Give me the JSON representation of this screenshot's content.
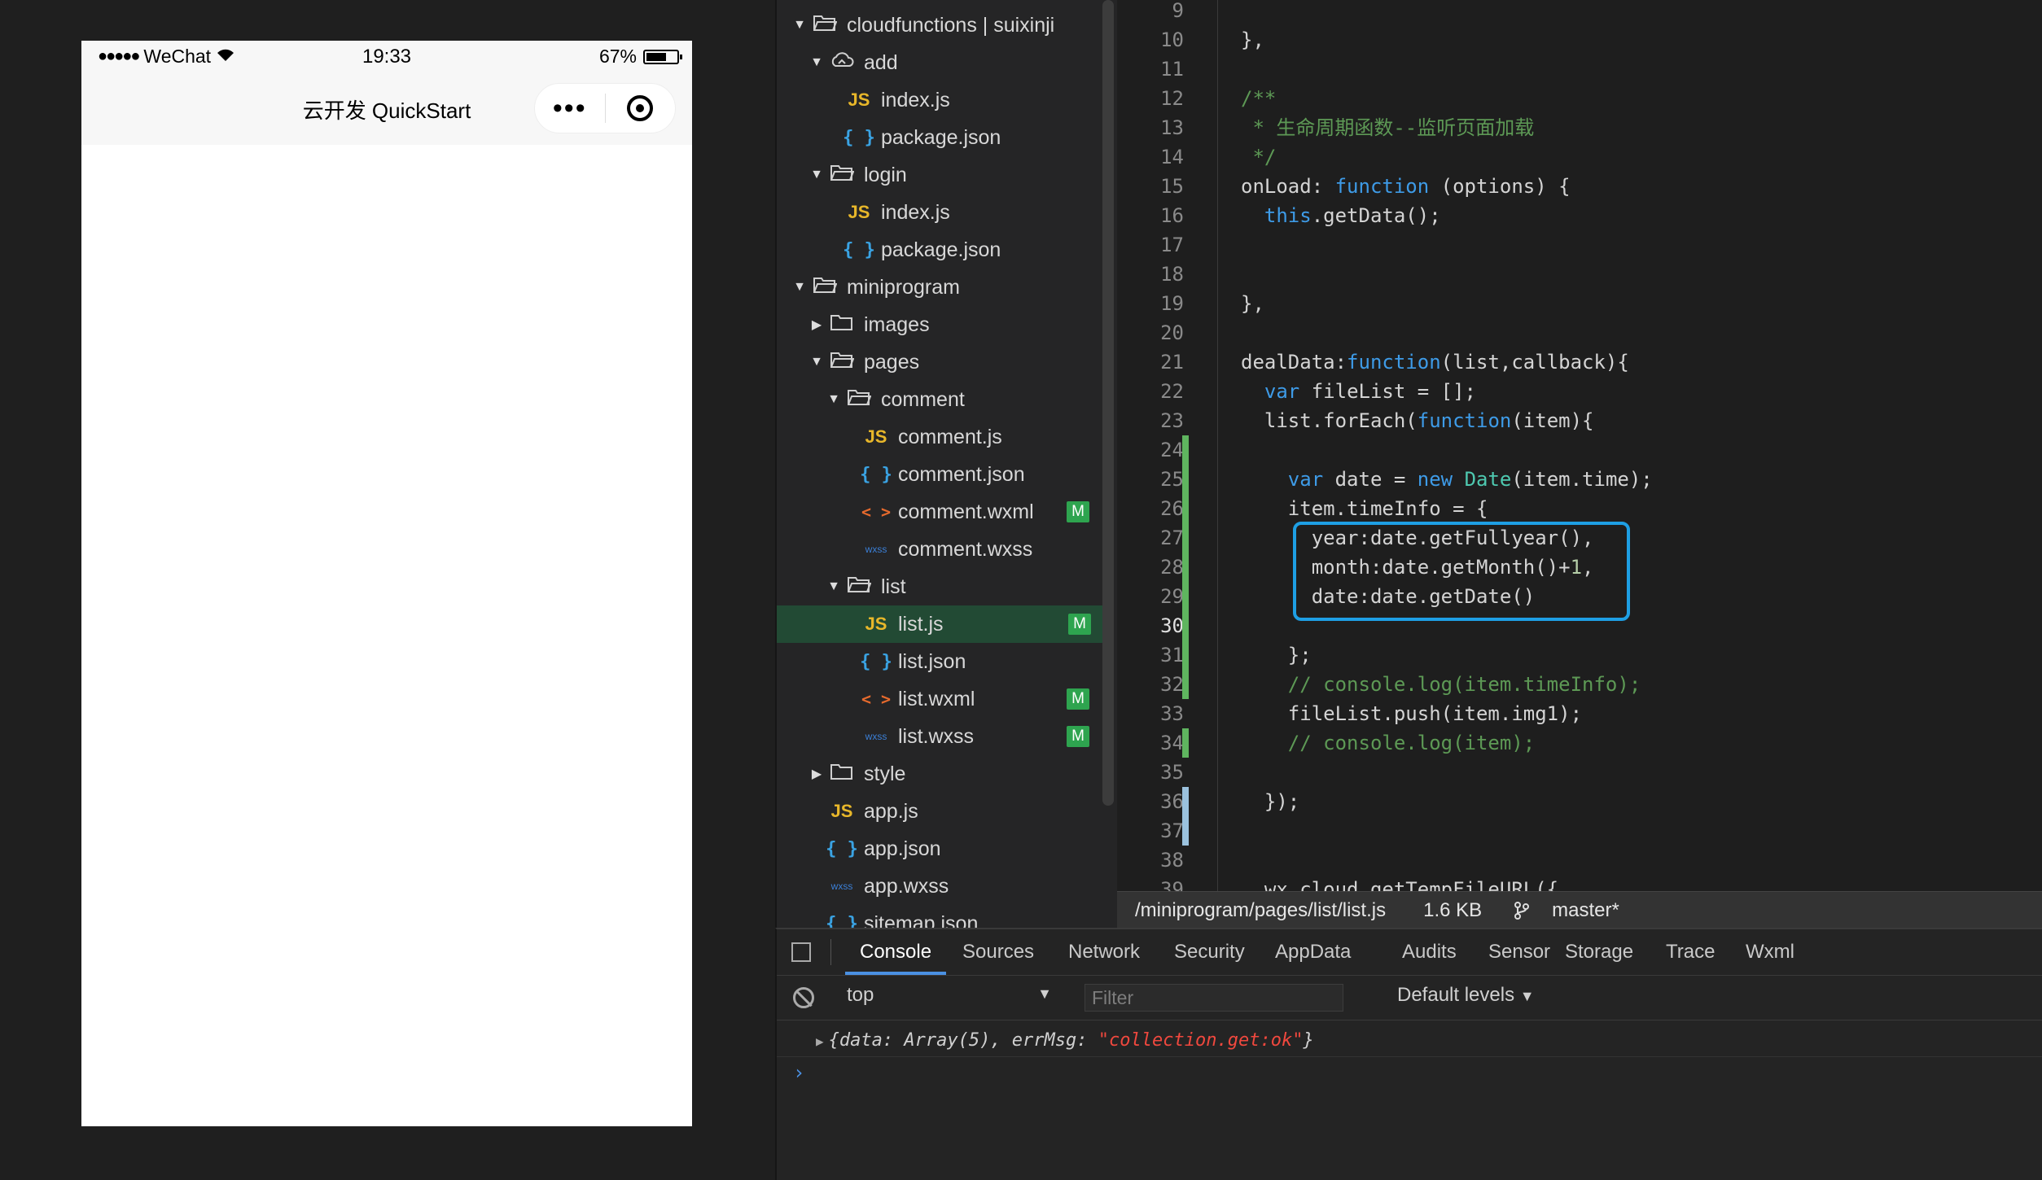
{
  "simulator": {
    "status_bar": {
      "signal": "●●●●●",
      "carrier": "WeChat",
      "time": "19:33",
      "battery": "67%",
      "battery_level": 0.67
    },
    "nav_title": "云开发 QuickStart",
    "capsule": {
      "more": "•••"
    }
  },
  "file_tree": [
    {
      "label": "cloudfunctions | suixinji",
      "icon": "folder-open-icon",
      "type": "folder",
      "expanded": true
    },
    {
      "label": "add",
      "icon": "cloud-folder-icon",
      "type": "cloud",
      "expanded": true
    },
    {
      "label": "index.js",
      "icon": "js-file-icon",
      "type": "js"
    },
    {
      "label": "package.json",
      "icon": "json-file-icon",
      "type": "json"
    },
    {
      "label": "login",
      "icon": "folder-open-icon",
      "type": "folder",
      "expanded": true
    },
    {
      "label": "index.js",
      "icon": "js-file-icon",
      "type": "js"
    },
    {
      "label": "package.json",
      "icon": "json-file-icon",
      "type": "json"
    },
    {
      "label": "miniprogram",
      "icon": "folder-open-icon",
      "type": "folder",
      "expanded": true
    },
    {
      "label": "images",
      "icon": "folder-icon",
      "type": "folder",
      "expanded": false
    },
    {
      "label": "pages",
      "icon": "folder-open-icon",
      "type": "folder",
      "expanded": true
    },
    {
      "label": "comment",
      "icon": "folder-open-icon",
      "type": "folder",
      "expanded": true
    },
    {
      "label": "comment.js",
      "icon": "js-file-icon",
      "type": "js"
    },
    {
      "label": "comment.json",
      "icon": "json-file-icon",
      "type": "json"
    },
    {
      "label": "comment.wxml",
      "icon": "wxml-file-icon",
      "type": "wxml",
      "badge": "M"
    },
    {
      "label": "comment.wxss",
      "icon": "wxss-file-icon",
      "type": "wxss"
    },
    {
      "label": "list",
      "icon": "folder-open-icon",
      "type": "folder",
      "expanded": true
    },
    {
      "label": "list.js",
      "icon": "js-file-icon",
      "type": "js",
      "badge": "M",
      "selected": true
    },
    {
      "label": "list.json",
      "icon": "json-file-icon",
      "type": "json"
    },
    {
      "label": "list.wxml",
      "icon": "wxml-file-icon",
      "type": "wxml",
      "badge": "M"
    },
    {
      "label": "list.wxss",
      "icon": "wxss-file-icon",
      "type": "wxss",
      "badge": "M"
    },
    {
      "label": "style",
      "icon": "folder-icon",
      "type": "folder",
      "expanded": false
    },
    {
      "label": "app.js",
      "icon": "js-file-icon",
      "type": "js"
    },
    {
      "label": "app.json",
      "icon": "json-file-icon",
      "type": "json"
    },
    {
      "label": "app.wxss",
      "icon": "wxss-file-icon",
      "type": "wxss"
    },
    {
      "label": "sitemap.json",
      "icon": "json-file-icon",
      "type": "json"
    }
  ],
  "editor": {
    "current_line": 30,
    "lines": [
      {
        "n": "9",
        "text": ""
      },
      {
        "n": "10",
        "text": "},"
      },
      {
        "n": "11",
        "text": ""
      },
      {
        "n": "12",
        "text": "/**"
      },
      {
        "n": "13",
        "text": " * 生命周期函数--监听页面加载"
      },
      {
        "n": "14",
        "text": " */"
      },
      {
        "n": "15",
        "text": "onLoad: function (options) {"
      },
      {
        "n": "16",
        "text": "  this.getData();"
      },
      {
        "n": "17",
        "text": ""
      },
      {
        "n": "18",
        "text": ""
      },
      {
        "n": "19",
        "text": "},"
      },
      {
        "n": "20",
        "text": ""
      },
      {
        "n": "21",
        "text": "dealData:function(list,callback){"
      },
      {
        "n": "22",
        "text": "  var fileList = [];"
      },
      {
        "n": "23",
        "text": "  list.forEach(function(item){"
      },
      {
        "n": "24",
        "text": ""
      },
      {
        "n": "25",
        "text": "    var date = new Date(item.time);"
      },
      {
        "n": "26",
        "text": "    item.timeInfo = {"
      },
      {
        "n": "27",
        "text": "      year:date.getFullyear(),"
      },
      {
        "n": "28",
        "text": "      month:date.getMonth()+1,"
      },
      {
        "n": "29",
        "text": "      date:date.getDate()"
      },
      {
        "n": "30",
        "text": ""
      },
      {
        "n": "31",
        "text": "    };"
      },
      {
        "n": "32",
        "text": "    // console.log(item.timeInfo);"
      },
      {
        "n": "33",
        "text": "    fileList.push(item.img1);"
      },
      {
        "n": "34",
        "text": "    // console.log(item);"
      },
      {
        "n": "35",
        "text": ""
      },
      {
        "n": "36",
        "text": "  });"
      },
      {
        "n": "37",
        "text": ""
      },
      {
        "n": "38",
        "text": ""
      },
      {
        "n": "39",
        "text": "  wx.cloud.getTempFileURL({"
      }
    ]
  },
  "status_bar": {
    "path": "/miniprogram/pages/list/list.js",
    "size": "1.6 KB",
    "branch": "master*"
  },
  "devtools": {
    "tabs": [
      "Console",
      "Sources",
      "Network",
      "Security",
      "AppData",
      "Audits",
      "Sensor",
      "Storage",
      "Trace",
      "Wxml"
    ],
    "active_tab": "Console",
    "context": "top",
    "filter_placeholder": "Filter",
    "levels": "Default levels",
    "console_output": {
      "prefix": "{data: Array(5), errMsg: ",
      "string": "\"collection.get:ok\"",
      "suffix": "}"
    },
    "prompt": "›"
  }
}
